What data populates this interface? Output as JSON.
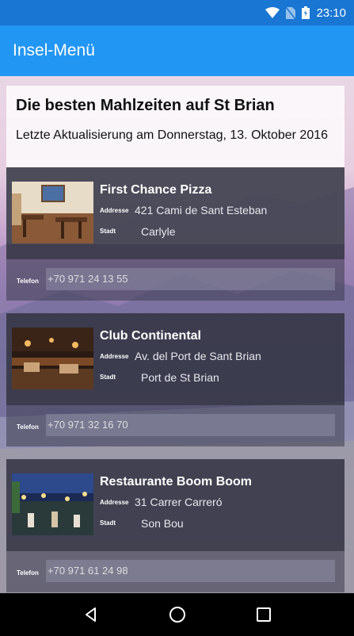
{
  "status_bar": {
    "time": "23:10",
    "icons": [
      "wifi-icon",
      "no-sim-icon",
      "battery-icon"
    ]
  },
  "app_bar": {
    "title": "Insel-Menü"
  },
  "header": {
    "title": "Die besten Mahlzeiten auf St Brian",
    "subtitle": "Letzte Aktualisierung am Donnerstag, 13. Oktober 2016"
  },
  "labels": {
    "address": "Addresse",
    "city": "Stadt",
    "phone": "Telefon"
  },
  "restaurants": [
    {
      "name": "First Chance Pizza",
      "address": "421 Cami de Sant Esteban",
      "city": "Carlyle",
      "phone": "+70 971 24 13 55"
    },
    {
      "name": "Club Continental",
      "address": "Av. del Port de Sant Brian",
      "city": "Port de St Brian",
      "phone": "+70 971 32 16 70"
    },
    {
      "name": "Restaurante Boom Boom",
      "address": "31 Carrer Carreró",
      "city": "Son Bou",
      "phone": "+70 971 61 24 98"
    }
  ],
  "nav": {
    "icons": [
      "back-icon",
      "home-icon",
      "recents-icon"
    ]
  },
  "colors": {
    "status_bar": "#1976d2",
    "app_bar": "#2196f3",
    "card": "#343444"
  }
}
